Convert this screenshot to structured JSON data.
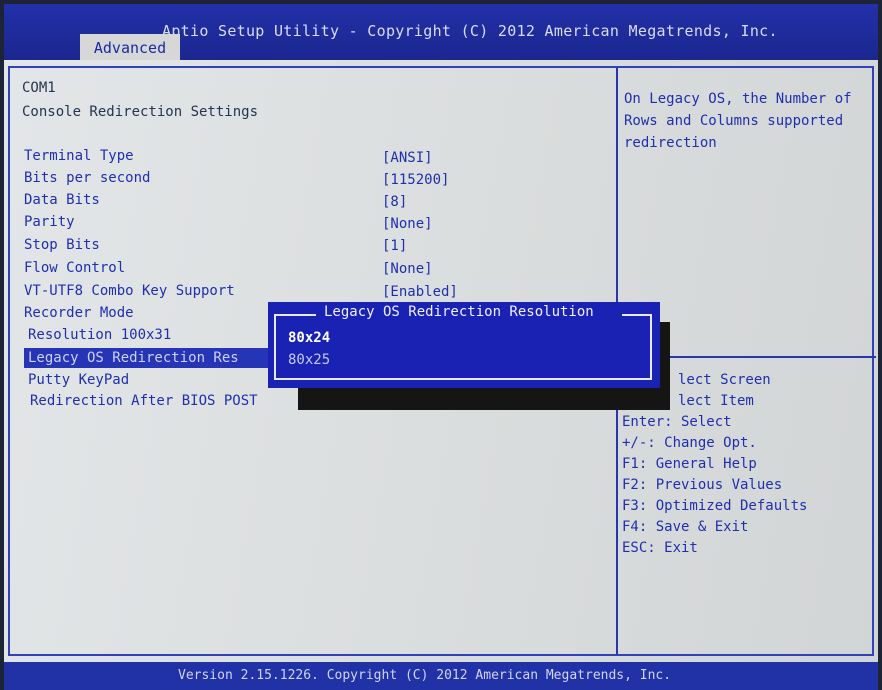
{
  "header": {
    "title": "Aptio Setup Utility - Copyright (C) 2012 American Megatrends, Inc.",
    "tab": "Advanced"
  },
  "main": {
    "section": "COM1",
    "subsection": "Console Redirection Settings",
    "settings": [
      {
        "label": "Terminal Type",
        "value": "[ANSI]"
      },
      {
        "label": "Bits per second",
        "value": "[115200]"
      },
      {
        "label": "Data Bits",
        "value": "[8]"
      },
      {
        "label": "Parity",
        "value": "[None]"
      },
      {
        "label": "Stop Bits",
        "value": "[1]"
      },
      {
        "label": "Flow Control",
        "value": "[None]"
      },
      {
        "label": "VT-UTF8 Combo Key Support",
        "value": "[Enabled]"
      },
      {
        "label": "Recorder Mode",
        "value": ""
      },
      {
        "label": "Resolution 100x31",
        "value": ""
      },
      {
        "label": "Legacy OS Redirection Res",
        "value": ""
      },
      {
        "label": "Putty KeyPad",
        "value": ""
      },
      {
        "label": "Redirection After BIOS POST",
        "value": ""
      }
    ]
  },
  "help": {
    "lines": [
      "On Legacy OS, the Number of",
      "Rows and Columns supported",
      "redirection"
    ]
  },
  "keys": [
    "lect Screen",
    "lect Item",
    "Enter: Select",
    "+/-: Change Opt.",
    "F1: General Help",
    "F2: Previous Values",
    "F3: Optimized Defaults",
    "F4: Save & Exit",
    "ESC: Exit"
  ],
  "popup": {
    "title": "Legacy OS Redirection Resolution",
    "options": [
      "80x24",
      "80x25"
    ],
    "selected": "80x24"
  },
  "footer": {
    "text": "Version 2.15.1226. Copyright (C) 2012 American Megatrends, Inc."
  },
  "colors": {
    "header_blue": "#2330a8",
    "text_blue": "#1f2fb0",
    "panel_grey": "#e0e3e5",
    "popup_blue": "#1a22b4",
    "tab_grey": "#d7d7d7"
  }
}
